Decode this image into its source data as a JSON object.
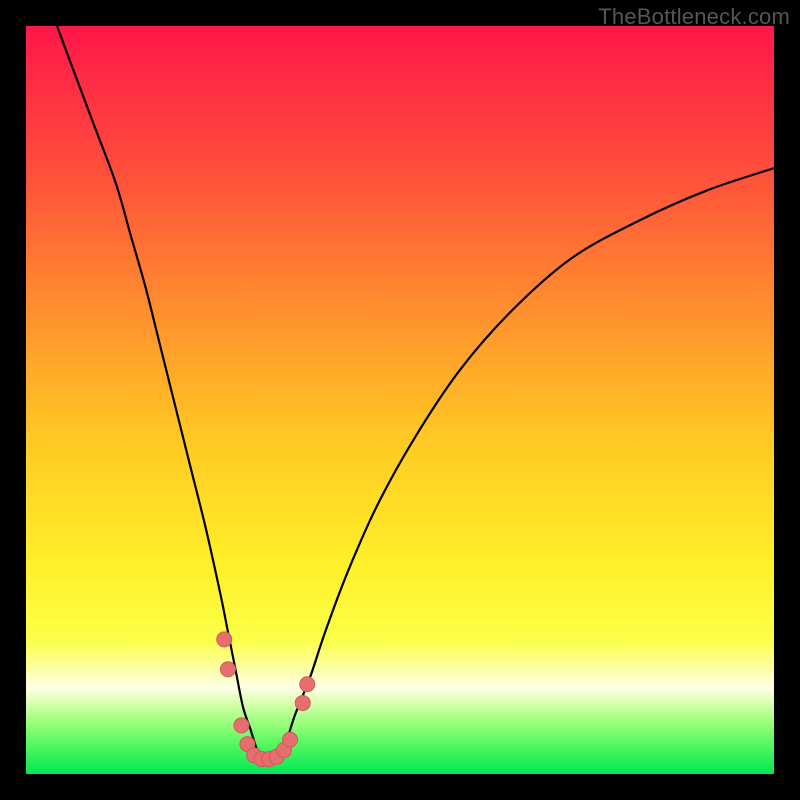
{
  "watermark": "TheBottleneck.com",
  "colors": {
    "gradient_top": "#ff1749",
    "gradient_upper_mid": "#ff7933",
    "gradient_mid": "#ffdd22",
    "gradient_lower_mid": "#f7ff37",
    "gradient_band_pale": "#fbffb8",
    "gradient_near_bottom": "#8eff70",
    "gradient_bottom": "#00e756",
    "curve": "#000000",
    "marker_fill": "#e46f6e",
    "marker_stroke": "#d35a58",
    "background": "#000000"
  },
  "chart_data": {
    "type": "line",
    "title": "",
    "xlabel": "",
    "ylabel": "",
    "xlim": [
      0,
      100
    ],
    "ylim": [
      0,
      100
    ],
    "series": [
      {
        "name": "bottleneck-curve",
        "x": [
          0,
          3,
          6,
          9,
          12,
          14,
          16,
          18,
          20,
          22,
          24,
          26,
          27,
          28,
          29,
          30,
          31,
          32,
          33,
          34,
          35,
          36,
          38,
          40,
          43,
          47,
          52,
          58,
          65,
          73,
          82,
          91,
          100
        ],
        "y": [
          110,
          103,
          95,
          87,
          79,
          72,
          65,
          57,
          49,
          41,
          33,
          24,
          19,
          14,
          9,
          6,
          3,
          2,
          2,
          3,
          5,
          8,
          13,
          19,
          27,
          36,
          45,
          54,
          62,
          69,
          74,
          78,
          81
        ]
      }
    ],
    "markers": [
      {
        "x": 26.5,
        "y": 18,
        "r": 5
      },
      {
        "x": 27.0,
        "y": 14,
        "r": 5
      },
      {
        "x": 28.8,
        "y": 6.5,
        "r": 5
      },
      {
        "x": 29.6,
        "y": 4.0,
        "r": 5
      },
      {
        "x": 30.5,
        "y": 2.5,
        "r": 5
      },
      {
        "x": 31.5,
        "y": 2.0,
        "r": 5
      },
      {
        "x": 32.5,
        "y": 2.0,
        "r": 5
      },
      {
        "x": 33.5,
        "y": 2.3,
        "r": 5
      },
      {
        "x": 34.5,
        "y": 3.2,
        "r": 5
      },
      {
        "x": 35.3,
        "y": 4.6,
        "r": 5
      },
      {
        "x": 37.0,
        "y": 9.5,
        "r": 5
      },
      {
        "x": 37.6,
        "y": 12.0,
        "r": 5
      }
    ],
    "grid": false,
    "legend": {
      "visible": false
    }
  }
}
